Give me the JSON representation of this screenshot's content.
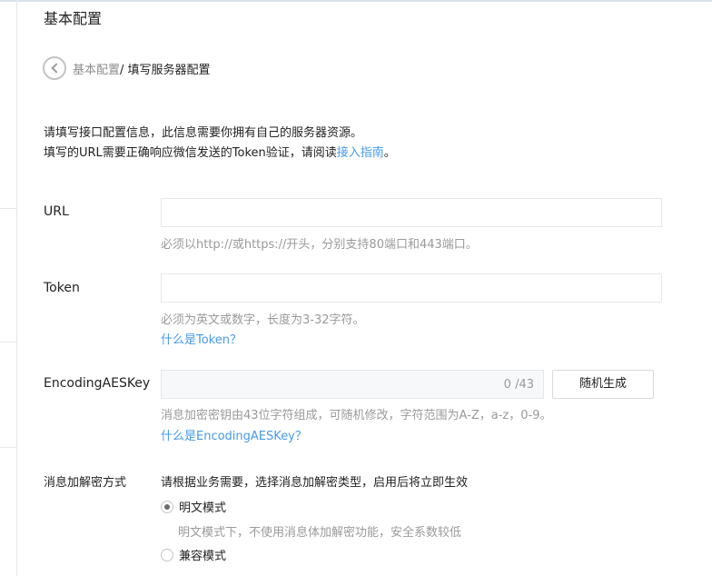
{
  "page": {
    "title": "基本配置"
  },
  "breadcrumb": {
    "parent": "基本配置",
    "separator": "/ ",
    "current": "填写服务器配置"
  },
  "intro": {
    "line1": "请填写接口配置信息，此信息需要你拥有自己的服务器资源。",
    "line2_prefix": "填写的URL需要正确响应微信发送的Token验证，请阅读",
    "line2_link": "接入指南",
    "line2_suffix": "。"
  },
  "form": {
    "url": {
      "label": "URL",
      "value": "",
      "hint": "必须以http://或https://开头，分别支持80端口和443端口。"
    },
    "token": {
      "label": "Token",
      "value": "",
      "hint": "必须为英文或数字，长度为3-32字符。",
      "help_link": "什么是Token？"
    },
    "aeskey": {
      "label": "EncodingAESKey",
      "counter": "0 /43",
      "generate_button": "随机生成",
      "hint": "消息加密密钥由43位字符组成，可随机修改，字符范围为A-Z，a-z，0-9。",
      "help_link": "什么是EncodingAESKey？"
    },
    "encryption": {
      "label": "消息加解密方式",
      "description": "请根据业务需要，选择消息加解密类型，启用后将立即生效",
      "options": [
        {
          "label": "明文模式",
          "hint": "明文模式下，不使用消息体加解密功能，安全系数较低",
          "checked": true
        },
        {
          "label": "兼容模式",
          "checked": false
        }
      ]
    }
  },
  "colors": {
    "link": "#459ae9",
    "hint": "#9a9a9a",
    "text": "#222222"
  }
}
